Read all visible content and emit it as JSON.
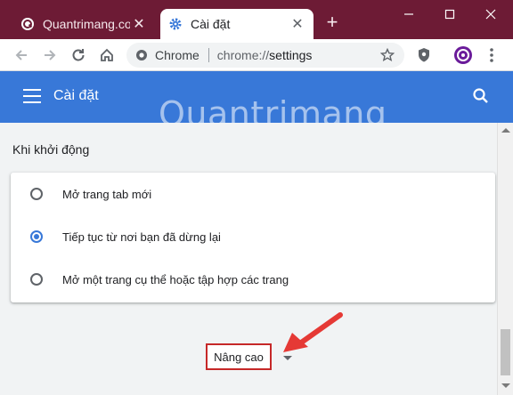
{
  "tabs": [
    {
      "title": "Quantrimang.com: K",
      "active": false,
      "icon": "quantrimang-favicon"
    },
    {
      "title": "Cài đặt",
      "active": true,
      "icon": "settings-gear-icon"
    }
  ],
  "new_tab_label": "+",
  "window_controls": {
    "minimize": "minimize-icon",
    "maximize": "maximize-icon",
    "close": "close-icon"
  },
  "omnibox": {
    "chip": "Chrome",
    "url_scheme": "chrome://",
    "url_path": "settings"
  },
  "header": {
    "title": "Cài đặt"
  },
  "watermark": "Quantrimang",
  "startup": {
    "title": "Khi khởi động",
    "options": [
      {
        "label": "Mở trang tab mới",
        "checked": false
      },
      {
        "label": "Tiếp tục từ nơi bạn đã dừng lại",
        "checked": true
      },
      {
        "label": "Mở một trang cụ thể hoặc tập hợp các trang",
        "checked": false
      }
    ]
  },
  "advanced": {
    "label": "Nâng cao"
  },
  "colors": {
    "titlebar": "#6d1b35",
    "header": "#3878d8",
    "radio_checked": "#3878d8",
    "highlight_box": "#c62828",
    "annotation_arrow": "#e53935"
  }
}
